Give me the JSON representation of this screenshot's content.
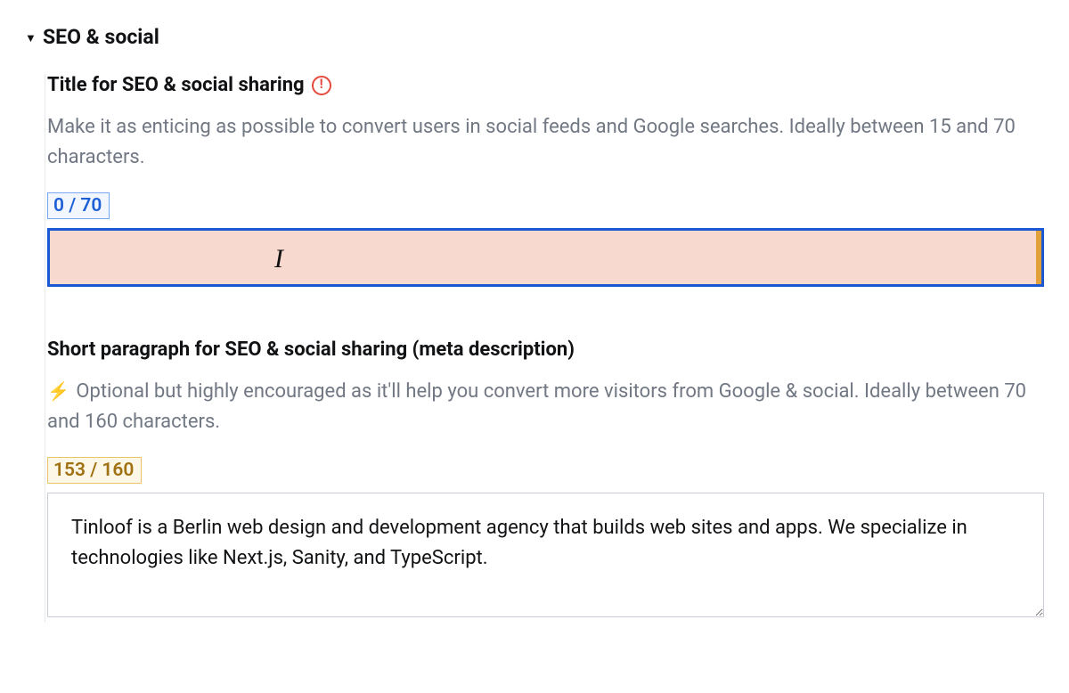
{
  "section": {
    "title": "SEO & social"
  },
  "fields": {
    "title": {
      "label": "Title for SEO & social sharing",
      "help": "Make it as enticing as possible to convert users in social feeds and Google searches. Ideally between 15 and 70 characters.",
      "counter": "0 / 70",
      "value": ""
    },
    "description": {
      "label": "Short paragraph for SEO & social sharing (meta description)",
      "bolt_icon": "⚡",
      "help": "Optional but highly encouraged as it'll help you convert more visitors from Google & social. Ideally between 70 and 160 characters.",
      "counter": "153 / 160",
      "value": "Tinloof is a Berlin web design and development agency that builds web sites and apps. We specialize in technologies like Next.js, Sanity, and TypeScript."
    }
  }
}
